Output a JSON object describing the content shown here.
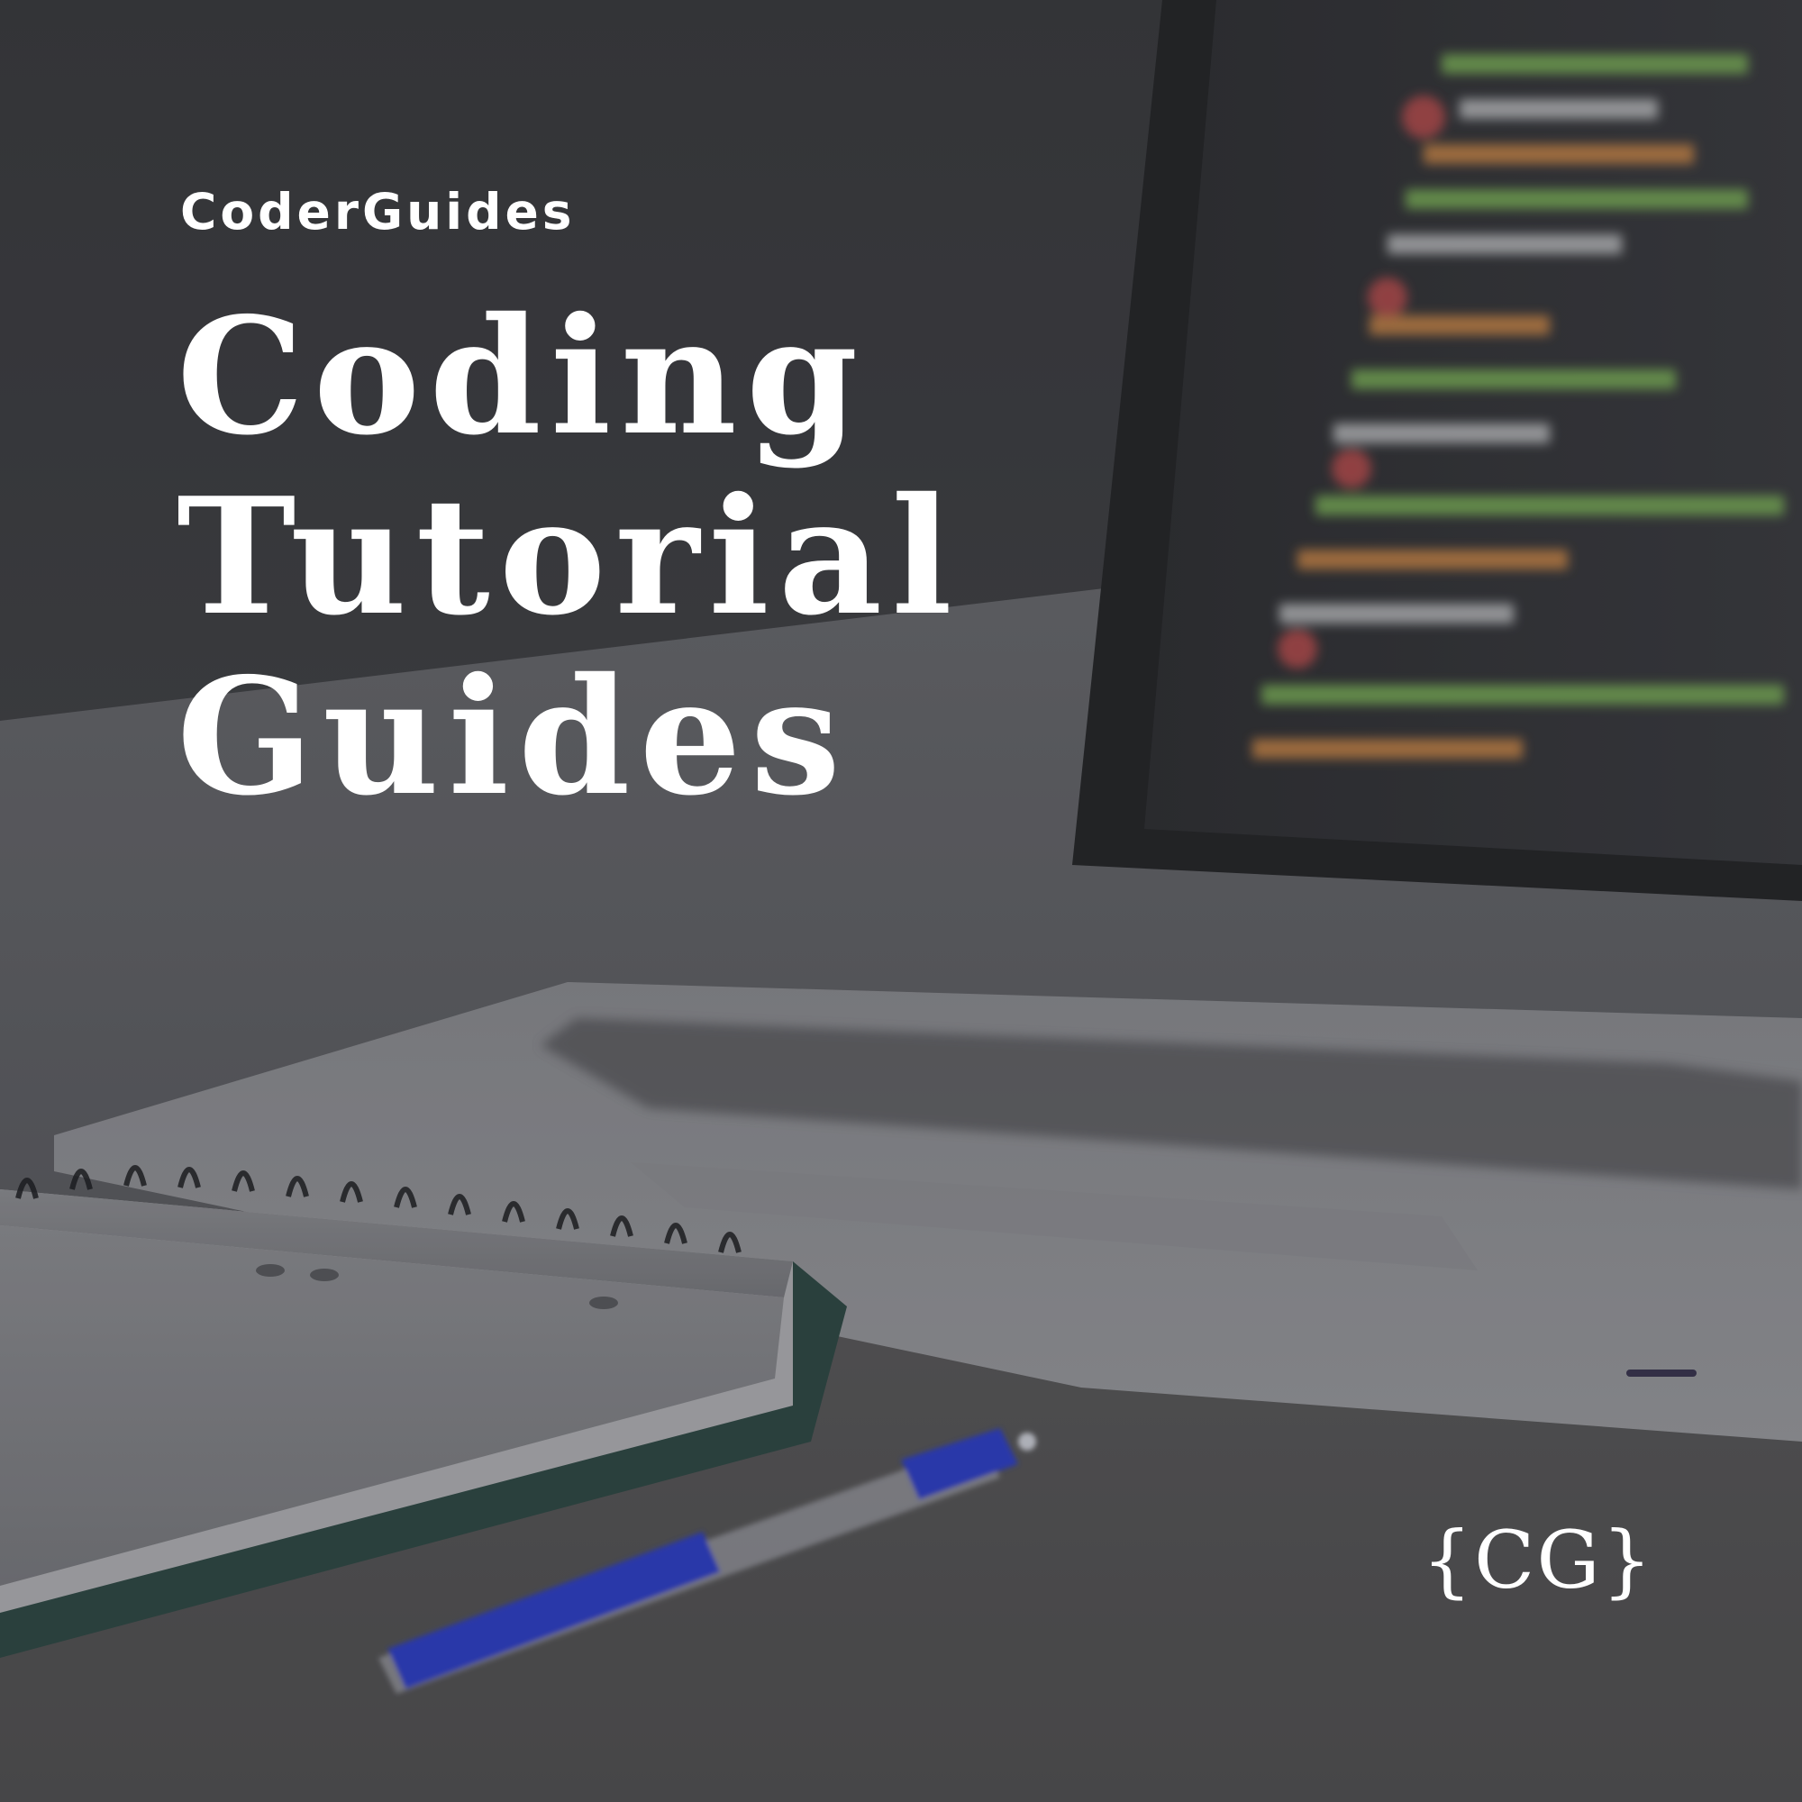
{
  "cover": {
    "brand": "CoderGuides",
    "headline_lines": [
      "Coding",
      "Tutorial",
      "Guides"
    ],
    "mark": "{CG}"
  },
  "colors": {
    "text": "#ffffff",
    "background_dark": "#3c3d40",
    "pen_blue": "#2f3fc8"
  },
  "icons": [
    "laptop-illustration",
    "notebook-illustration",
    "pen-illustration"
  ]
}
